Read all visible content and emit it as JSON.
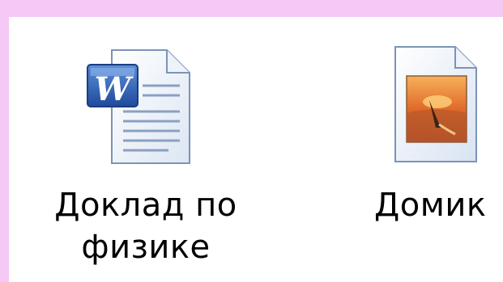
{
  "desktop": {
    "items": [
      {
        "name_line1": "Доклад по",
        "name_line2": "физике",
        "icon": "word-document-icon"
      },
      {
        "name_line1": "Домик",
        "icon": "image-file-icon"
      }
    ]
  },
  "colors": {
    "frame": "#f6c8f6",
    "word_blue": "#2a5aa8"
  }
}
